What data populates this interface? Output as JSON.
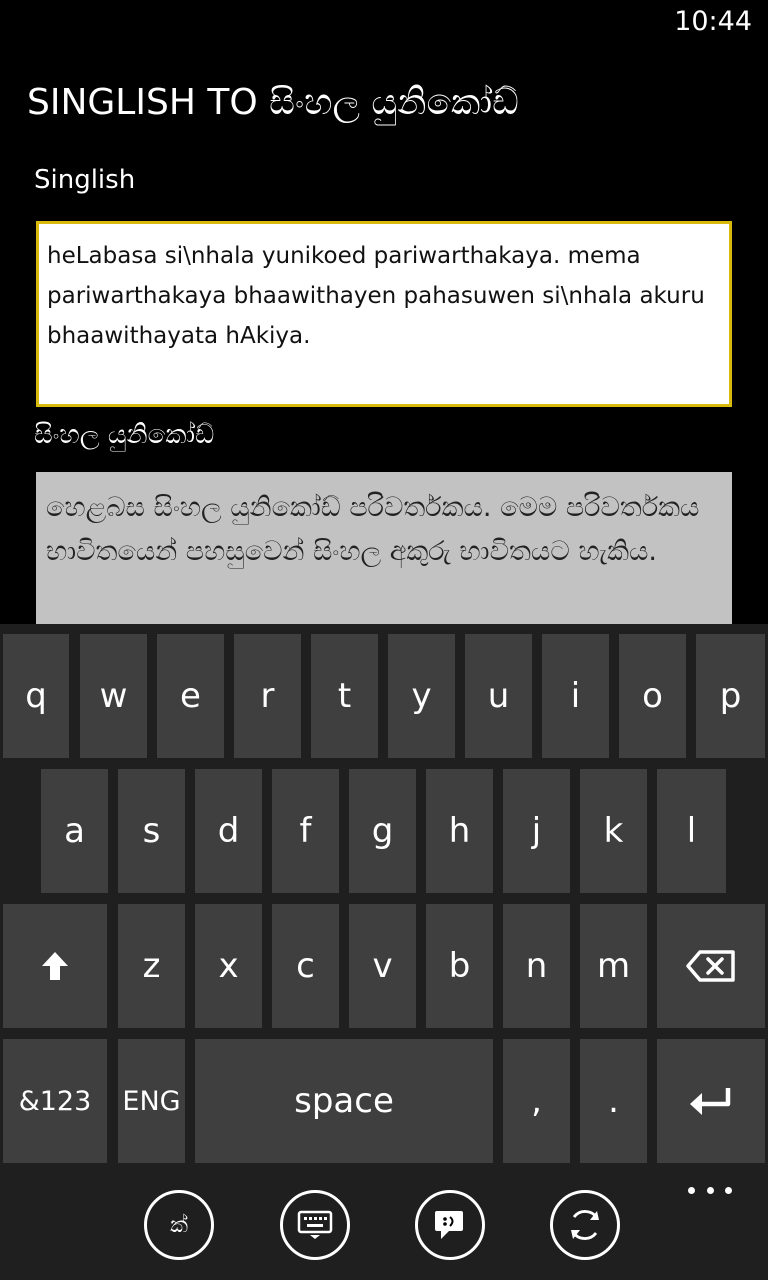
{
  "status": {
    "time": "10:44"
  },
  "app": {
    "title": "SINGLISH TO සිංහල යුනිකෝඩ්"
  },
  "singlish": {
    "label": "Singlish",
    "value": "heLabasa si\\nhala yunikoed pariwarthakaya. mema pariwarthakaya bhaawithayen pahasuwen si\\nhala akuru bhaawithayata hAkiya."
  },
  "unicode": {
    "label": "සිංහල යුනිකෝඩ්",
    "value": "හෙළබස සිංහල යුනිකෝඩ් පරිවර්තකය. මෙම පරිවර්තකය භාවිතයෙන් පහසුවෙන් සිංහල අකුරු භාවිතයට හැකිය."
  },
  "keyboard": {
    "row1": [
      "q",
      "w",
      "e",
      "r",
      "t",
      "y",
      "u",
      "i",
      "o",
      "p"
    ],
    "row2": [
      "a",
      "s",
      "d",
      "f",
      "g",
      "h",
      "j",
      "k",
      "l"
    ],
    "row3": [
      "z",
      "x",
      "c",
      "v",
      "b",
      "n",
      "m"
    ],
    "numbers_label": "&123",
    "language_label": "ENG",
    "space_label": "space",
    "comma_label": ",",
    "period_label": "."
  },
  "appbar": {
    "buttons": [
      {
        "icon": "sinhala-script-icon",
        "glyph": "ක්‍"
      },
      {
        "icon": "keyboard-icon"
      },
      {
        "icon": "chat-icon"
      },
      {
        "icon": "refresh-icon"
      }
    ]
  },
  "colors": {
    "background": "#000000",
    "accent_border": "#d9b90b",
    "key": "#3f3f3f",
    "keyboard_bg": "#1f1f1f",
    "output_bg": "#c2c2c2"
  }
}
